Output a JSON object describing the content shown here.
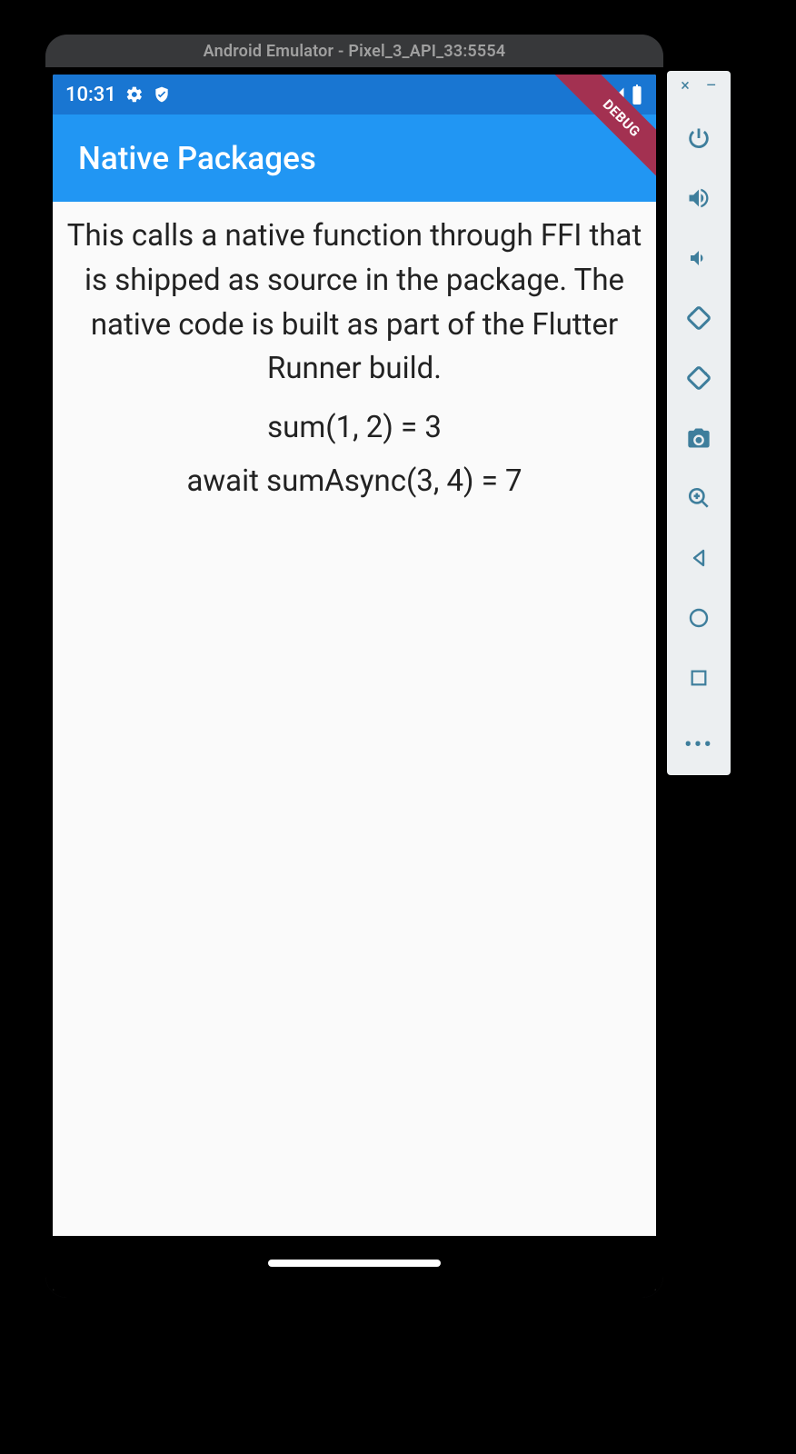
{
  "emulator": {
    "title": "Android Emulator - Pixel_3_API_33:5554"
  },
  "status": {
    "time": "10:31"
  },
  "appbar": {
    "title": "Native Packages"
  },
  "debug_banner": "DEBUG",
  "content": {
    "lead": "This calls a native function through FFI that is shipped as source in the package. The native code is built as part of the Flutter Runner build.",
    "line1": "sum(1, 2) = 3",
    "line2": "await sumAsync(3, 4) = 7"
  },
  "toolbar": {
    "close": "×",
    "minimize": "–",
    "more": "•••"
  }
}
